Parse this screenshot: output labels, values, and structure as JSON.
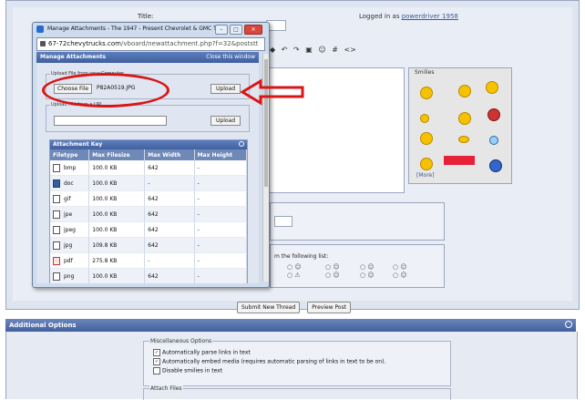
{
  "page": {
    "title_label": "Title:",
    "logged_in_prefix": "Logged in as",
    "username": "powerdriver 1958",
    "smilies_label": "Smilies",
    "smilies_more": "[More]",
    "from_list_text": "m the following list:",
    "submit_button": "Submit New Thread",
    "preview_button": "Preview Post"
  },
  "additional_options": {
    "title": "Additional Options",
    "misc_legend": "Miscellaneous Options",
    "opt1": "Automatically parse links in text",
    "opt2": "Automatically embed media (requires automatic parsing of links in text to be on).",
    "opt3": "Disable smilies in text",
    "attach_legend": "Attach Files"
  },
  "popup": {
    "window_title": "Manage Attachments - The 1947 - Present Chevrolet & GMC Tru...",
    "url_domain": "67-72chevytrucks.com",
    "url_path": "/vboard/newattachment.php?f=32&poststt",
    "header": "Manage Attachments",
    "close_link": "Close this window",
    "upload_computer_legend": "Upload File from your Computer",
    "choose_file": "Choose File",
    "file_name": "P82A0519.JPG",
    "upload_button": "Upload",
    "upload_url_legend": "Upload File from a URL",
    "upload_button2": "Upload",
    "attachment_key": "Attachment Key",
    "columns": [
      "Filetype",
      "Max Filesize",
      "Max Width",
      "Max Height"
    ],
    "rows": [
      {
        "type": "bmp",
        "size": "100.0 KB",
        "width": "642",
        "height": "-",
        "icon": "image-file-icon"
      },
      {
        "type": "doc",
        "size": "100.0 KB",
        "width": "-",
        "height": "-",
        "icon": "doc-file-icon"
      },
      {
        "type": "gif",
        "size": "100.0 KB",
        "width": "642",
        "height": "-",
        "icon": "image-file-icon"
      },
      {
        "type": "jpe",
        "size": "100.0 KB",
        "width": "642",
        "height": "-",
        "icon": "image-file-icon"
      },
      {
        "type": "jpeg",
        "size": "100.0 KB",
        "width": "642",
        "height": "-",
        "icon": "image-file-icon"
      },
      {
        "type": "jpg",
        "size": "109.8 KB",
        "width": "642",
        "height": "-",
        "icon": "image-file-icon"
      },
      {
        "type": "pdf",
        "size": "275.8 KB",
        "width": "-",
        "height": "-",
        "icon": "pdf-file-icon"
      },
      {
        "type": "png",
        "size": "100.0 KB",
        "width": "642",
        "height": "-",
        "icon": "image-file-icon"
      }
    ]
  },
  "colors": {
    "header_blue": "#41609f",
    "annotation_red": "#d81616"
  }
}
